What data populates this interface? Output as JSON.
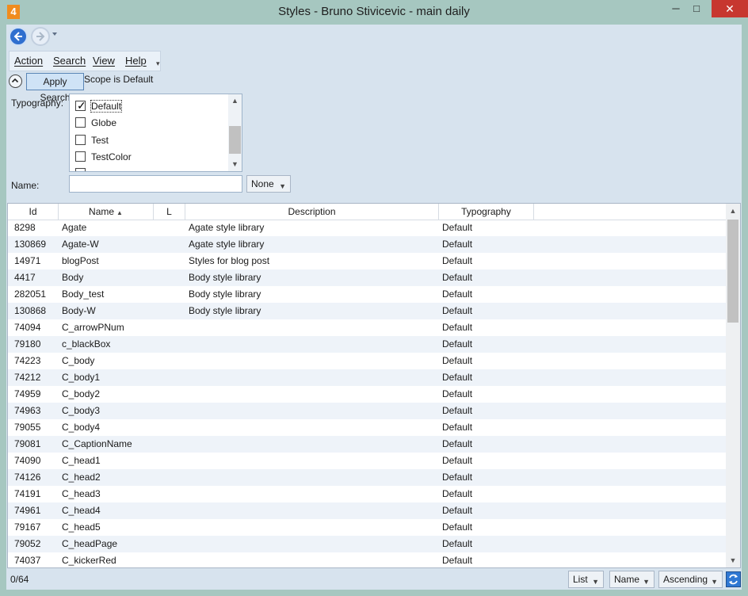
{
  "window": {
    "app_icon_label": "4",
    "title": "Styles - Bruno Stivicevic - main daily",
    "controls": {
      "minimize": "─",
      "maximize": "□",
      "close": "✕"
    }
  },
  "nav": {
    "back_icon": "back-arrow-icon",
    "forward_icon": "forward-arrow-icon"
  },
  "menu": {
    "items": [
      "Action",
      "Search",
      "View",
      "Help"
    ],
    "overflow": "▾"
  },
  "search": {
    "apply_label": "Apply Search",
    "scope_text": "Scope is Default",
    "typography_label": "Typography:",
    "typography_options": [
      {
        "label": "Default",
        "checked": true
      },
      {
        "label": "Globe",
        "checked": false
      },
      {
        "label": "Test",
        "checked": false
      },
      {
        "label": "TestColor",
        "checked": false
      }
    ],
    "name_label": "Name:",
    "name_value": "",
    "name_mode": "None"
  },
  "grid": {
    "columns": [
      "Id",
      "Name",
      "L",
      "Description",
      "Typography"
    ],
    "sort_indicator": "▲",
    "rows": [
      [
        "8298",
        "Agate",
        "",
        "Agate style library",
        "Default"
      ],
      [
        "130869",
        "Agate-W",
        "",
        "Agate style library",
        "Default"
      ],
      [
        "14971",
        "blogPost",
        "",
        "Styles for blog post",
        "Default"
      ],
      [
        "4417",
        "Body",
        "",
        "Body style library",
        "Default"
      ],
      [
        "282051",
        "Body_test",
        "",
        "Body style library",
        "Default"
      ],
      [
        "130868",
        "Body-W",
        "",
        "Body style library",
        "Default"
      ],
      [
        "74094",
        "C_arrowPNum",
        "",
        "",
        "Default"
      ],
      [
        "79180",
        "c_blackBox",
        "",
        "",
        "Default"
      ],
      [
        "74223",
        "C_body",
        "",
        "",
        "Default"
      ],
      [
        "74212",
        "C_body1",
        "",
        "",
        "Default"
      ],
      [
        "74959",
        "C_body2",
        "",
        "",
        "Default"
      ],
      [
        "74963",
        "C_body3",
        "",
        "",
        "Default"
      ],
      [
        "79055",
        "C_body4",
        "",
        "",
        "Default"
      ],
      [
        "79081",
        "C_CaptionName",
        "",
        "",
        "Default"
      ],
      [
        "74090",
        "C_head1",
        "",
        "",
        "Default"
      ],
      [
        "74126",
        "C_head2",
        "",
        "",
        "Default"
      ],
      [
        "74191",
        "C_head3",
        "",
        "",
        "Default"
      ],
      [
        "74961",
        "C_head4",
        "",
        "",
        "Default"
      ],
      [
        "79167",
        "C_head5",
        "",
        "",
        "Default"
      ],
      [
        "79052",
        "C_headPage",
        "",
        "",
        "Default"
      ],
      [
        "74037",
        "C_kickerRed",
        "",
        "",
        "Default"
      ]
    ]
  },
  "status": {
    "count": "0/64",
    "view_mode": "List",
    "sort_field": "Name",
    "sort_order": "Ascending",
    "refresh_icon": "refresh-icon"
  }
}
